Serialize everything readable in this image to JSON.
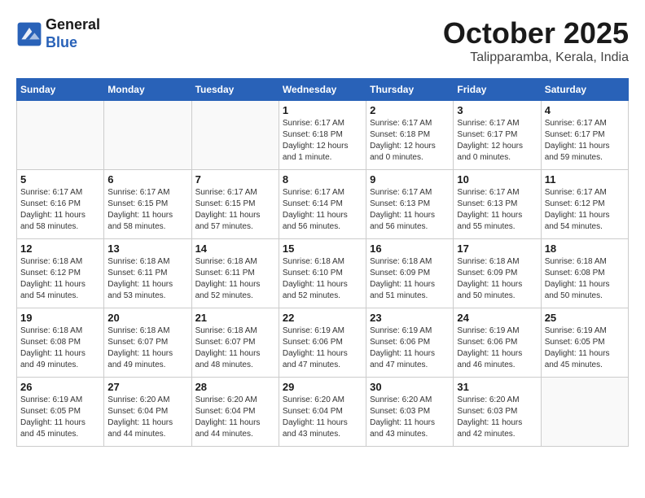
{
  "header": {
    "logo_line1": "General",
    "logo_line2": "Blue",
    "month": "October 2025",
    "location": "Talipparamba, Kerala, India"
  },
  "weekdays": [
    "Sunday",
    "Monday",
    "Tuesday",
    "Wednesday",
    "Thursday",
    "Friday",
    "Saturday"
  ],
  "weeks": [
    [
      {
        "day": "",
        "info": ""
      },
      {
        "day": "",
        "info": ""
      },
      {
        "day": "",
        "info": ""
      },
      {
        "day": "1",
        "info": "Sunrise: 6:17 AM\nSunset: 6:18 PM\nDaylight: 12 hours\nand 1 minute."
      },
      {
        "day": "2",
        "info": "Sunrise: 6:17 AM\nSunset: 6:18 PM\nDaylight: 12 hours\nand 0 minutes."
      },
      {
        "day": "3",
        "info": "Sunrise: 6:17 AM\nSunset: 6:17 PM\nDaylight: 12 hours\nand 0 minutes."
      },
      {
        "day": "4",
        "info": "Sunrise: 6:17 AM\nSunset: 6:17 PM\nDaylight: 11 hours\nand 59 minutes."
      }
    ],
    [
      {
        "day": "5",
        "info": "Sunrise: 6:17 AM\nSunset: 6:16 PM\nDaylight: 11 hours\nand 58 minutes."
      },
      {
        "day": "6",
        "info": "Sunrise: 6:17 AM\nSunset: 6:15 PM\nDaylight: 11 hours\nand 58 minutes."
      },
      {
        "day": "7",
        "info": "Sunrise: 6:17 AM\nSunset: 6:15 PM\nDaylight: 11 hours\nand 57 minutes."
      },
      {
        "day": "8",
        "info": "Sunrise: 6:17 AM\nSunset: 6:14 PM\nDaylight: 11 hours\nand 56 minutes."
      },
      {
        "day": "9",
        "info": "Sunrise: 6:17 AM\nSunset: 6:13 PM\nDaylight: 11 hours\nand 56 minutes."
      },
      {
        "day": "10",
        "info": "Sunrise: 6:17 AM\nSunset: 6:13 PM\nDaylight: 11 hours\nand 55 minutes."
      },
      {
        "day": "11",
        "info": "Sunrise: 6:17 AM\nSunset: 6:12 PM\nDaylight: 11 hours\nand 54 minutes."
      }
    ],
    [
      {
        "day": "12",
        "info": "Sunrise: 6:18 AM\nSunset: 6:12 PM\nDaylight: 11 hours\nand 54 minutes."
      },
      {
        "day": "13",
        "info": "Sunrise: 6:18 AM\nSunset: 6:11 PM\nDaylight: 11 hours\nand 53 minutes."
      },
      {
        "day": "14",
        "info": "Sunrise: 6:18 AM\nSunset: 6:11 PM\nDaylight: 11 hours\nand 52 minutes."
      },
      {
        "day": "15",
        "info": "Sunrise: 6:18 AM\nSunset: 6:10 PM\nDaylight: 11 hours\nand 52 minutes."
      },
      {
        "day": "16",
        "info": "Sunrise: 6:18 AM\nSunset: 6:09 PM\nDaylight: 11 hours\nand 51 minutes."
      },
      {
        "day": "17",
        "info": "Sunrise: 6:18 AM\nSunset: 6:09 PM\nDaylight: 11 hours\nand 50 minutes."
      },
      {
        "day": "18",
        "info": "Sunrise: 6:18 AM\nSunset: 6:08 PM\nDaylight: 11 hours\nand 50 minutes."
      }
    ],
    [
      {
        "day": "19",
        "info": "Sunrise: 6:18 AM\nSunset: 6:08 PM\nDaylight: 11 hours\nand 49 minutes."
      },
      {
        "day": "20",
        "info": "Sunrise: 6:18 AM\nSunset: 6:07 PM\nDaylight: 11 hours\nand 49 minutes."
      },
      {
        "day": "21",
        "info": "Sunrise: 6:18 AM\nSunset: 6:07 PM\nDaylight: 11 hours\nand 48 minutes."
      },
      {
        "day": "22",
        "info": "Sunrise: 6:19 AM\nSunset: 6:06 PM\nDaylight: 11 hours\nand 47 minutes."
      },
      {
        "day": "23",
        "info": "Sunrise: 6:19 AM\nSunset: 6:06 PM\nDaylight: 11 hours\nand 47 minutes."
      },
      {
        "day": "24",
        "info": "Sunrise: 6:19 AM\nSunset: 6:06 PM\nDaylight: 11 hours\nand 46 minutes."
      },
      {
        "day": "25",
        "info": "Sunrise: 6:19 AM\nSunset: 6:05 PM\nDaylight: 11 hours\nand 45 minutes."
      }
    ],
    [
      {
        "day": "26",
        "info": "Sunrise: 6:19 AM\nSunset: 6:05 PM\nDaylight: 11 hours\nand 45 minutes."
      },
      {
        "day": "27",
        "info": "Sunrise: 6:20 AM\nSunset: 6:04 PM\nDaylight: 11 hours\nand 44 minutes."
      },
      {
        "day": "28",
        "info": "Sunrise: 6:20 AM\nSunset: 6:04 PM\nDaylight: 11 hours\nand 44 minutes."
      },
      {
        "day": "29",
        "info": "Sunrise: 6:20 AM\nSunset: 6:04 PM\nDaylight: 11 hours\nand 43 minutes."
      },
      {
        "day": "30",
        "info": "Sunrise: 6:20 AM\nSunset: 6:03 PM\nDaylight: 11 hours\nand 43 minutes."
      },
      {
        "day": "31",
        "info": "Sunrise: 6:20 AM\nSunset: 6:03 PM\nDaylight: 11 hours\nand 42 minutes."
      },
      {
        "day": "",
        "info": ""
      }
    ]
  ]
}
